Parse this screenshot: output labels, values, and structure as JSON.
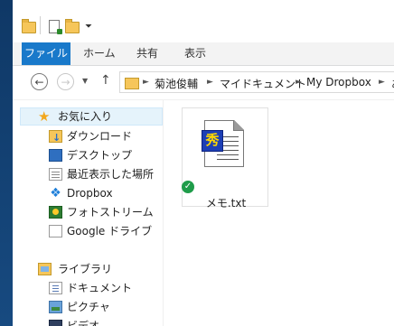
{
  "ribbon": {
    "tabs": [
      "ファイル",
      "ホーム",
      "共有",
      "表示"
    ]
  },
  "address": {
    "breadcrumbs": [
      "菊池俊輔",
      "マイドキュメント",
      "My Dropbox",
      "あ"
    ]
  },
  "navpane": {
    "favorites": {
      "label": "お気に入り",
      "items": [
        "ダウンロード",
        "デスクトップ",
        "最近表示した場所",
        "Dropbox",
        "フォトストリーム",
        "Google ドライブ"
      ]
    },
    "libraries": {
      "label": "ライブラリ",
      "items": [
        "ドキュメント",
        "ピクチャ",
        "ビデオ"
      ]
    }
  },
  "content": {
    "files": [
      {
        "name": "メモ.txt",
        "badge_glyph": "秀",
        "sync_status": "synced"
      }
    ]
  },
  "colors": {
    "file_tab": "#1979ca",
    "selection": "#e5f3fb",
    "sync_ok": "#1f9c4a"
  }
}
